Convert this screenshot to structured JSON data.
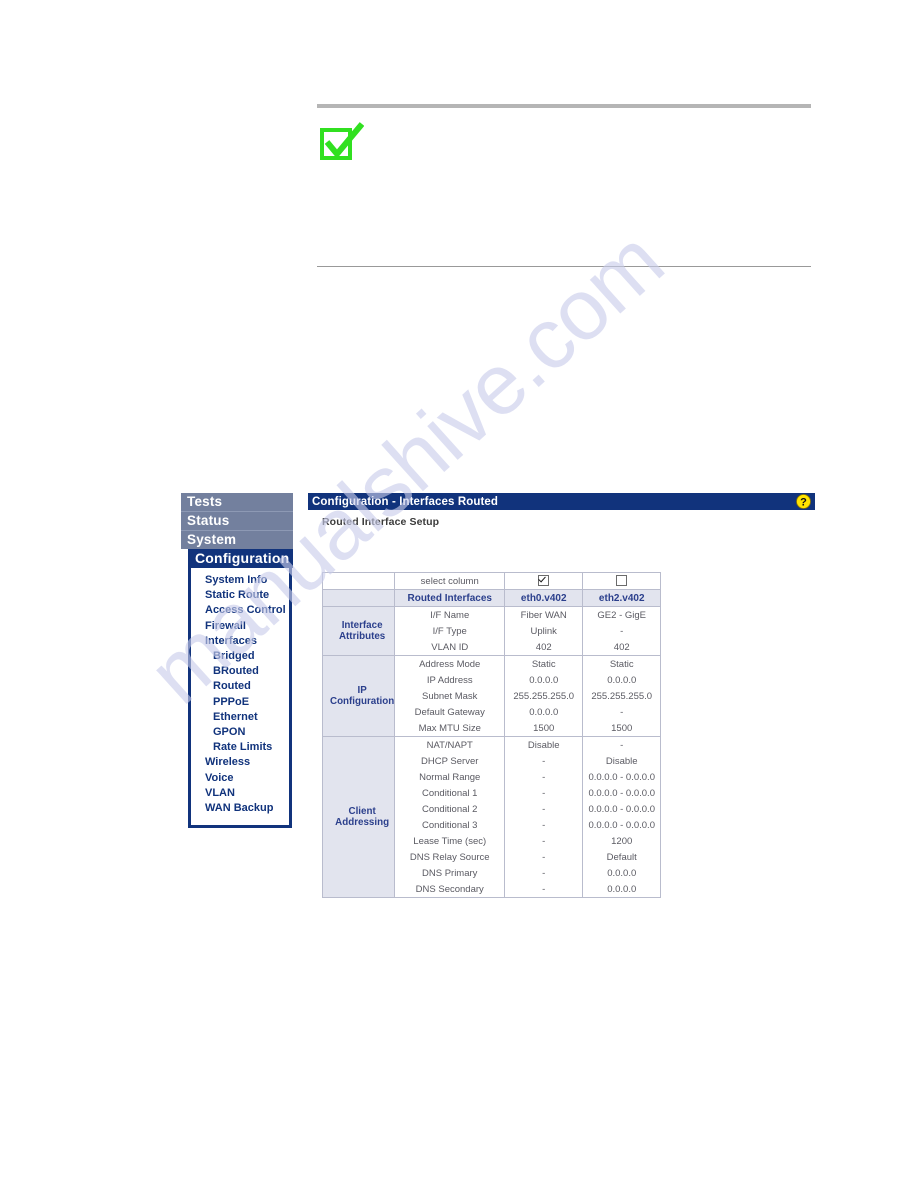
{
  "page": {
    "note": {
      "icon": "green-check-box-icon",
      "icon_color": "#31e020",
      "text": ""
    },
    "watermark": "manualshive.com"
  },
  "device_ui": {
    "nav": {
      "tabs": [
        {
          "label": "Tests",
          "active": false
        },
        {
          "label": "Status",
          "active": false
        },
        {
          "label": "System",
          "active": false
        },
        {
          "label": "Configuration",
          "active": true
        }
      ],
      "items": [
        {
          "label": "System Info",
          "sub": false
        },
        {
          "label": "Static Route",
          "sub": false
        },
        {
          "label": "Access Control",
          "sub": false
        },
        {
          "label": "Firewall",
          "sub": false
        },
        {
          "label": "Interfaces",
          "sub": false
        },
        {
          "label": "Bridged",
          "sub": true
        },
        {
          "label": "BRouted",
          "sub": true
        },
        {
          "label": "Routed",
          "sub": true
        },
        {
          "label": "PPPoE",
          "sub": true
        },
        {
          "label": "Ethernet",
          "sub": true
        },
        {
          "label": "GPON",
          "sub": true
        },
        {
          "label": "Rate Limits",
          "sub": true
        },
        {
          "label": "Wireless",
          "sub": false
        },
        {
          "label": "Voice",
          "sub": false
        },
        {
          "label": "VLAN",
          "sub": false
        },
        {
          "label": "WAN Backup",
          "sub": false
        }
      ]
    },
    "header": {
      "title": "Configuration - Interfaces Routed",
      "subtitle": "Routed Interface Setup",
      "help_icon": "question-mark-help-icon",
      "title_bar_color": "#11337c",
      "help_icon_color": "#ffe400"
    },
    "table": {
      "select_column_label": "select column",
      "row_header_label": "Routed Interfaces",
      "columns": [
        {
          "name": "eth0.v402",
          "selected": true
        },
        {
          "name": "eth2.v402",
          "selected": false
        }
      ],
      "groups": [
        {
          "name": "Interface Attributes",
          "name_line1": "Interface",
          "name_line2": "Attributes",
          "rows": [
            {
              "label": "I/F Name",
              "values": [
                "Fiber WAN",
                "GE2 - GigE"
              ]
            },
            {
              "label": "I/F Type",
              "values": [
                "Uplink",
                "-"
              ]
            },
            {
              "label": "VLAN ID",
              "values": [
                "402",
                "402"
              ]
            }
          ]
        },
        {
          "name": "IP Configuration",
          "name_line1": "IP",
          "name_line2": "Configuration",
          "rows": [
            {
              "label": "Address Mode",
              "values": [
                "Static",
                "Static"
              ]
            },
            {
              "label": "IP Address",
              "values": [
                "0.0.0.0",
                "0.0.0.0"
              ]
            },
            {
              "label": "Subnet Mask",
              "values": [
                "255.255.255.0",
                "255.255.255.0"
              ]
            },
            {
              "label": "Default Gateway",
              "values": [
                "0.0.0.0",
                "-"
              ]
            },
            {
              "label": "Max MTU Size",
              "values": [
                "1500",
                "1500"
              ]
            }
          ]
        },
        {
          "name": "Client Addressing",
          "name_line1": "Client",
          "name_line2": "Addressing",
          "rows": [
            {
              "label": "NAT/NAPT",
              "values": [
                "Disable",
                "-"
              ]
            },
            {
              "label": "DHCP Server",
              "values": [
                "-",
                "Disable"
              ]
            },
            {
              "label": "Normal Range",
              "values": [
                "-",
                "0.0.0.0 - 0.0.0.0"
              ]
            },
            {
              "label": "Conditional 1",
              "values": [
                "-",
                "0.0.0.0 - 0.0.0.0"
              ]
            },
            {
              "label": "Conditional 2",
              "values": [
                "-",
                "0.0.0.0 - 0.0.0.0"
              ]
            },
            {
              "label": "Conditional 3",
              "values": [
                "-",
                "0.0.0.0 - 0.0.0.0"
              ]
            },
            {
              "label": "Lease Time (sec)",
              "values": [
                "-",
                "1200"
              ]
            },
            {
              "label": "DNS Relay Source",
              "values": [
                "-",
                "Default"
              ]
            },
            {
              "label": "DNS Primary",
              "values": [
                "-",
                "0.0.0.0"
              ]
            },
            {
              "label": "DNS Secondary",
              "values": [
                "-",
                "0.0.0.0"
              ]
            }
          ]
        }
      ]
    }
  }
}
